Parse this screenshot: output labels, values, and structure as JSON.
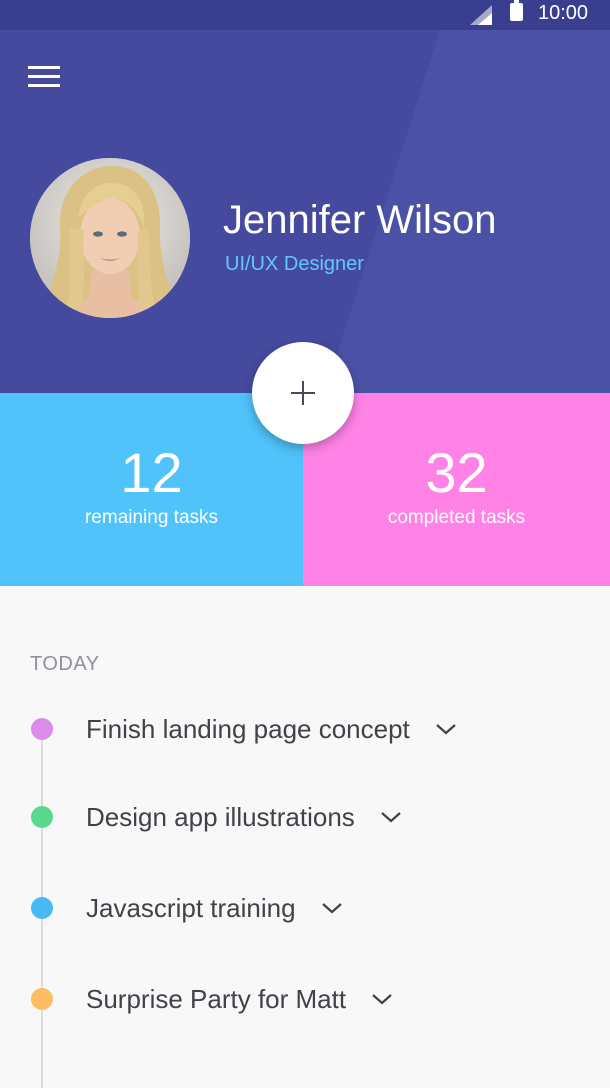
{
  "status_bar": {
    "time": "10:00",
    "signal_icon": "signal-icon",
    "battery_icon": "battery-icon"
  },
  "header": {
    "menu_icon": "menu-icon",
    "avatar_icon": "avatar-photo",
    "name": "Jennifer Wilson",
    "role": "UI/UX Designer"
  },
  "add_button": {
    "icon": "plus-icon"
  },
  "stats": {
    "remaining": {
      "value": "12",
      "label": "remaining tasks"
    },
    "completed": {
      "value": "32",
      "label": "completed tasks"
    }
  },
  "tasks": {
    "heading": "TODAY",
    "items": [
      {
        "title": "Finish landing page concept",
        "color": "#db8bea",
        "icon": "chevron-down-icon"
      },
      {
        "title": "Design app illustrations",
        "color": "#58d98d",
        "icon": "chevron-down-icon"
      },
      {
        "title": "Javascript training",
        "color": "#48b9f4",
        "icon": "chevron-down-icon"
      },
      {
        "title": "Surprise Party for Matt",
        "color": "#fdbd63",
        "icon": "chevron-down-icon"
      }
    ]
  },
  "colors": {
    "header_bg": "#454a9f",
    "status_bar_bg": "#3a3e8e",
    "role_text": "#5fc8ff",
    "remaining_bg": "#4fc3fa",
    "completed_bg": "#ff82e6"
  }
}
